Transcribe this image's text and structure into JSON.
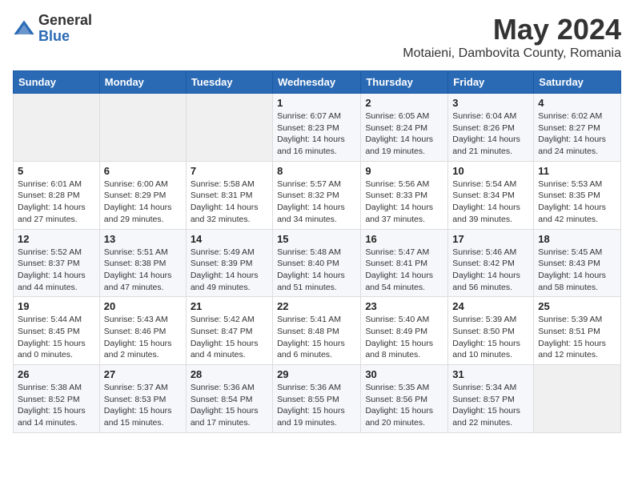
{
  "logo": {
    "general": "General",
    "blue": "Blue"
  },
  "title": "May 2024",
  "location": "Motaieni, Dambovita County, Romania",
  "weekdays": [
    "Sunday",
    "Monday",
    "Tuesday",
    "Wednesday",
    "Thursday",
    "Friday",
    "Saturday"
  ],
  "weeks": [
    [
      {
        "day": "",
        "info": ""
      },
      {
        "day": "",
        "info": ""
      },
      {
        "day": "",
        "info": ""
      },
      {
        "day": "1",
        "info": "Sunrise: 6:07 AM\nSunset: 8:23 PM\nDaylight: 14 hours and 16 minutes."
      },
      {
        "day": "2",
        "info": "Sunrise: 6:05 AM\nSunset: 8:24 PM\nDaylight: 14 hours and 19 minutes."
      },
      {
        "day": "3",
        "info": "Sunrise: 6:04 AM\nSunset: 8:26 PM\nDaylight: 14 hours and 21 minutes."
      },
      {
        "day": "4",
        "info": "Sunrise: 6:02 AM\nSunset: 8:27 PM\nDaylight: 14 hours and 24 minutes."
      }
    ],
    [
      {
        "day": "5",
        "info": "Sunrise: 6:01 AM\nSunset: 8:28 PM\nDaylight: 14 hours and 27 minutes."
      },
      {
        "day": "6",
        "info": "Sunrise: 6:00 AM\nSunset: 8:29 PM\nDaylight: 14 hours and 29 minutes."
      },
      {
        "day": "7",
        "info": "Sunrise: 5:58 AM\nSunset: 8:31 PM\nDaylight: 14 hours and 32 minutes."
      },
      {
        "day": "8",
        "info": "Sunrise: 5:57 AM\nSunset: 8:32 PM\nDaylight: 14 hours and 34 minutes."
      },
      {
        "day": "9",
        "info": "Sunrise: 5:56 AM\nSunset: 8:33 PM\nDaylight: 14 hours and 37 minutes."
      },
      {
        "day": "10",
        "info": "Sunrise: 5:54 AM\nSunset: 8:34 PM\nDaylight: 14 hours and 39 minutes."
      },
      {
        "day": "11",
        "info": "Sunrise: 5:53 AM\nSunset: 8:35 PM\nDaylight: 14 hours and 42 minutes."
      }
    ],
    [
      {
        "day": "12",
        "info": "Sunrise: 5:52 AM\nSunset: 8:37 PM\nDaylight: 14 hours and 44 minutes."
      },
      {
        "day": "13",
        "info": "Sunrise: 5:51 AM\nSunset: 8:38 PM\nDaylight: 14 hours and 47 minutes."
      },
      {
        "day": "14",
        "info": "Sunrise: 5:49 AM\nSunset: 8:39 PM\nDaylight: 14 hours and 49 minutes."
      },
      {
        "day": "15",
        "info": "Sunrise: 5:48 AM\nSunset: 8:40 PM\nDaylight: 14 hours and 51 minutes."
      },
      {
        "day": "16",
        "info": "Sunrise: 5:47 AM\nSunset: 8:41 PM\nDaylight: 14 hours and 54 minutes."
      },
      {
        "day": "17",
        "info": "Sunrise: 5:46 AM\nSunset: 8:42 PM\nDaylight: 14 hours and 56 minutes."
      },
      {
        "day": "18",
        "info": "Sunrise: 5:45 AM\nSunset: 8:43 PM\nDaylight: 14 hours and 58 minutes."
      }
    ],
    [
      {
        "day": "19",
        "info": "Sunrise: 5:44 AM\nSunset: 8:45 PM\nDaylight: 15 hours and 0 minutes."
      },
      {
        "day": "20",
        "info": "Sunrise: 5:43 AM\nSunset: 8:46 PM\nDaylight: 15 hours and 2 minutes."
      },
      {
        "day": "21",
        "info": "Sunrise: 5:42 AM\nSunset: 8:47 PM\nDaylight: 15 hours and 4 minutes."
      },
      {
        "day": "22",
        "info": "Sunrise: 5:41 AM\nSunset: 8:48 PM\nDaylight: 15 hours and 6 minutes."
      },
      {
        "day": "23",
        "info": "Sunrise: 5:40 AM\nSunset: 8:49 PM\nDaylight: 15 hours and 8 minutes."
      },
      {
        "day": "24",
        "info": "Sunrise: 5:39 AM\nSunset: 8:50 PM\nDaylight: 15 hours and 10 minutes."
      },
      {
        "day": "25",
        "info": "Sunrise: 5:39 AM\nSunset: 8:51 PM\nDaylight: 15 hours and 12 minutes."
      }
    ],
    [
      {
        "day": "26",
        "info": "Sunrise: 5:38 AM\nSunset: 8:52 PM\nDaylight: 15 hours and 14 minutes."
      },
      {
        "day": "27",
        "info": "Sunrise: 5:37 AM\nSunset: 8:53 PM\nDaylight: 15 hours and 15 minutes."
      },
      {
        "day": "28",
        "info": "Sunrise: 5:36 AM\nSunset: 8:54 PM\nDaylight: 15 hours and 17 minutes."
      },
      {
        "day": "29",
        "info": "Sunrise: 5:36 AM\nSunset: 8:55 PM\nDaylight: 15 hours and 19 minutes."
      },
      {
        "day": "30",
        "info": "Sunrise: 5:35 AM\nSunset: 8:56 PM\nDaylight: 15 hours and 20 minutes."
      },
      {
        "day": "31",
        "info": "Sunrise: 5:34 AM\nSunset: 8:57 PM\nDaylight: 15 hours and 22 minutes."
      },
      {
        "day": "",
        "info": ""
      }
    ]
  ]
}
